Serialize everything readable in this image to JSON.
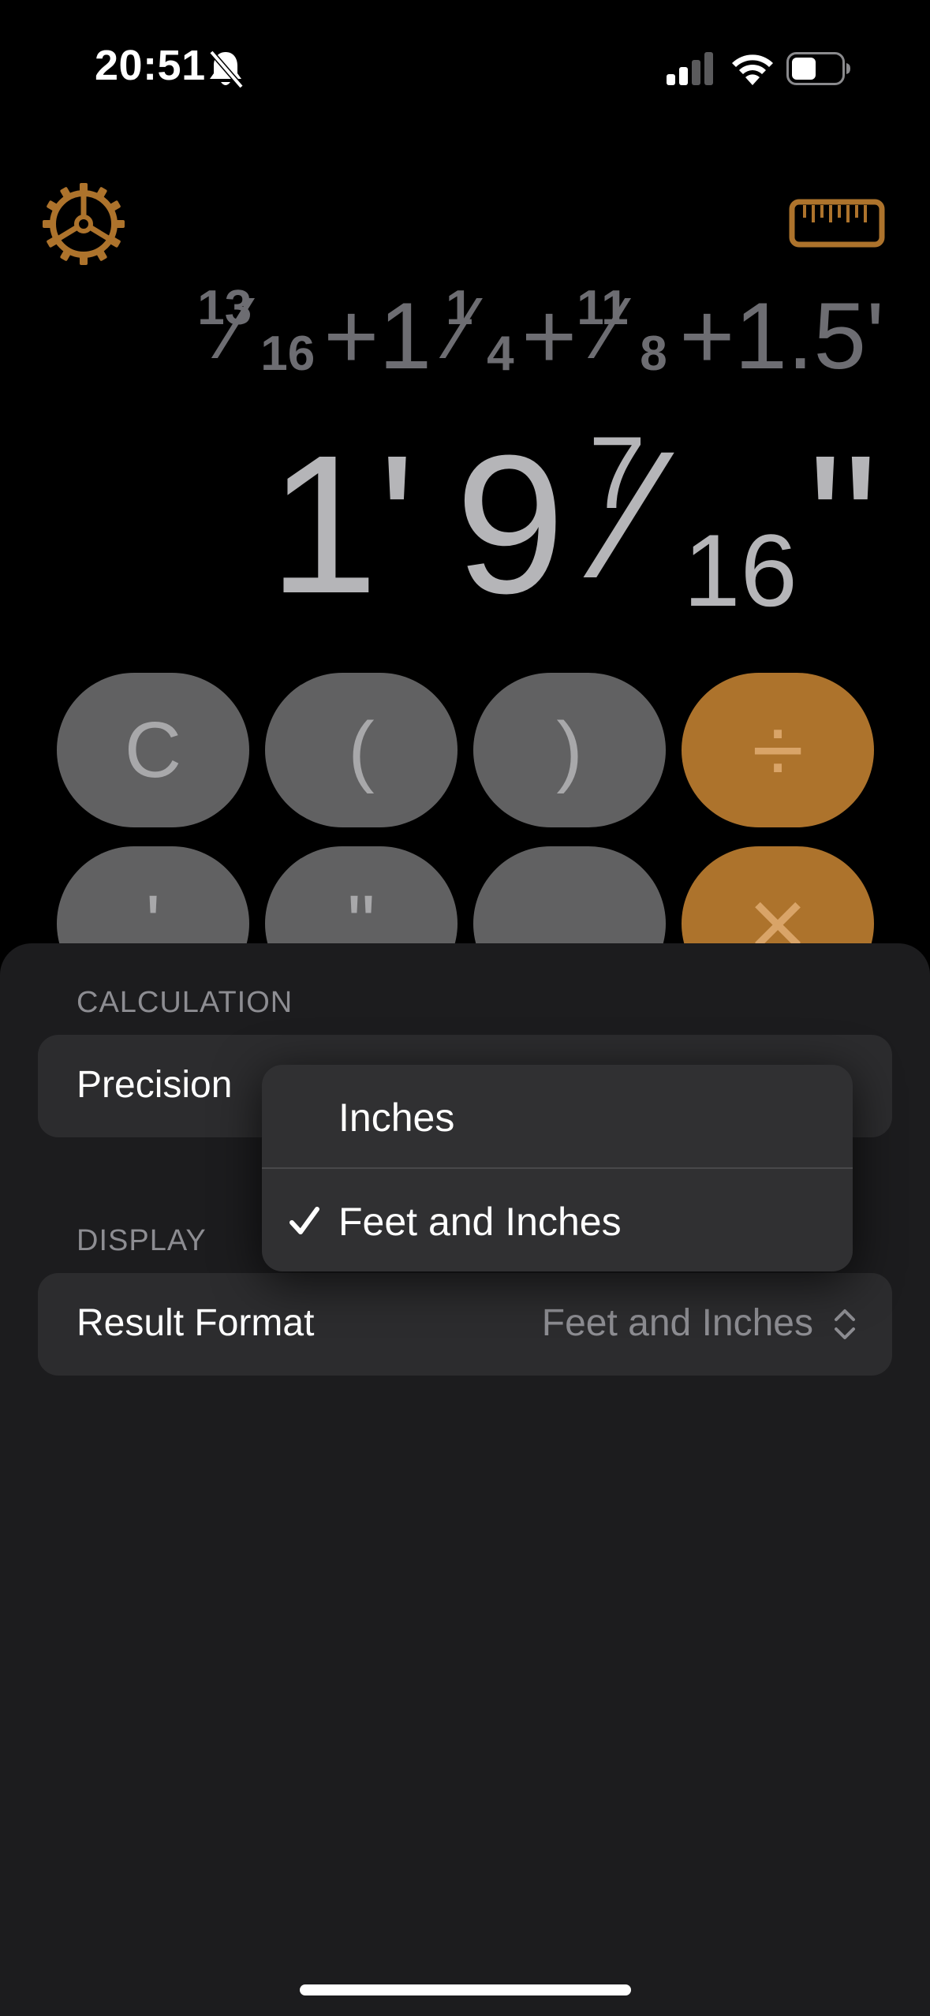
{
  "status_bar": {
    "time": "20:51"
  },
  "colors": {
    "accent": "#ad732c",
    "key_gray": "#616162",
    "sheet_bg": "#1c1c1e"
  },
  "display": {
    "expression": {
      "frac1_num": "13",
      "frac1_den": "16",
      "plus1": "+",
      "whole2": "1",
      "frac2_num": "1",
      "frac2_den": "4",
      "plus2": "+",
      "frac3_num": "11",
      "frac3_den": "8",
      "plus3": "+",
      "term4": "1.5'"
    },
    "result": {
      "feet": "1'",
      "inches": "9",
      "frac_num": "7",
      "frac_den": "16",
      "inch_mark": "\""
    }
  },
  "keypad": {
    "row1": [
      "C",
      "(",
      ")",
      "÷"
    ],
    "row2": [
      "'",
      "\"",
      "",
      "×"
    ]
  },
  "settings": {
    "calculation_header": "CALCULATION",
    "precision_label": "Precision",
    "display_header": "DISPLAY",
    "result_format_label": "Result Format",
    "result_format_value": "Feet and Inches"
  },
  "menu": {
    "options": [
      "Inches",
      "Feet and Inches"
    ],
    "selected": "Feet and Inches"
  },
  "icons": {
    "settings": "gear-icon",
    "ruler": "ruler-icon",
    "check": "checkmark-icon",
    "updown": "chevron-updown-icon"
  }
}
